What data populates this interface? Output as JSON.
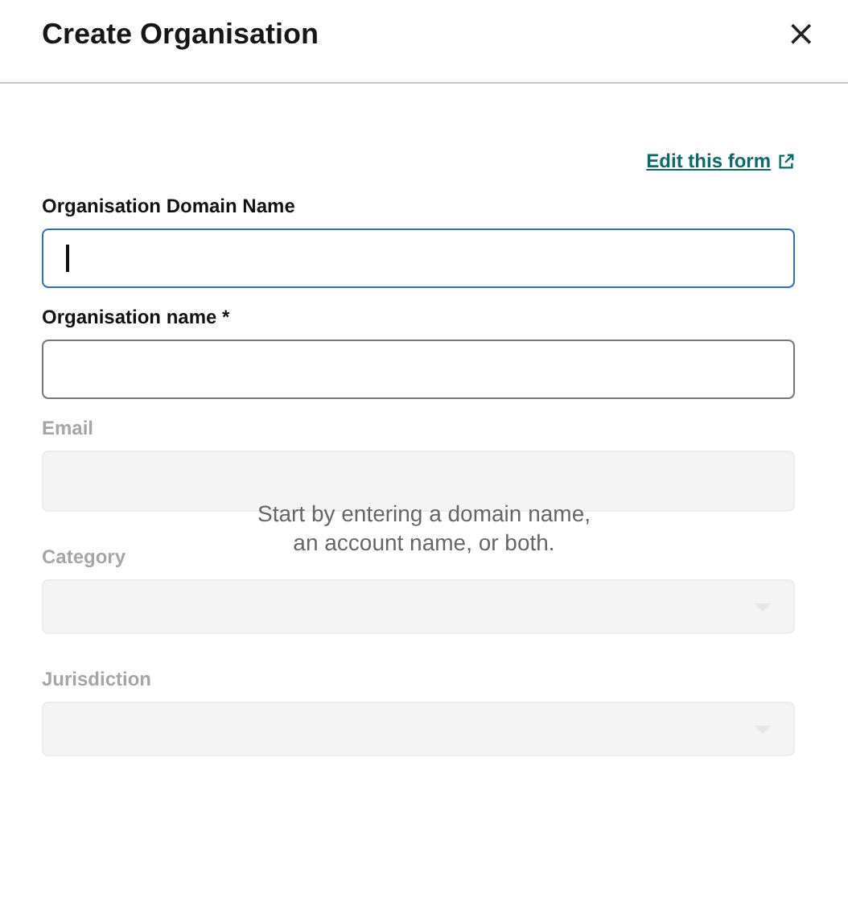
{
  "dialog": {
    "title": "Create Organisation",
    "close_icon": "×"
  },
  "edit_link": {
    "label": "Edit this form"
  },
  "fields": [
    {
      "label": "Organisation Domain Name",
      "kind": "text",
      "focused": true,
      "disabled": false
    },
    {
      "label": "Organisation name *",
      "kind": "text",
      "focused": false,
      "disabled": false
    },
    {
      "label": "Email",
      "kind": "text",
      "focused": false,
      "disabled": true
    },
    {
      "label": "Category",
      "kind": "select",
      "disabled": true
    },
    {
      "label": "Jurisdiction",
      "kind": "select",
      "disabled": true
    }
  ],
  "hint": {
    "lines": [
      "Start by entering a domain name,",
      "an account name, or both."
    ]
  }
}
